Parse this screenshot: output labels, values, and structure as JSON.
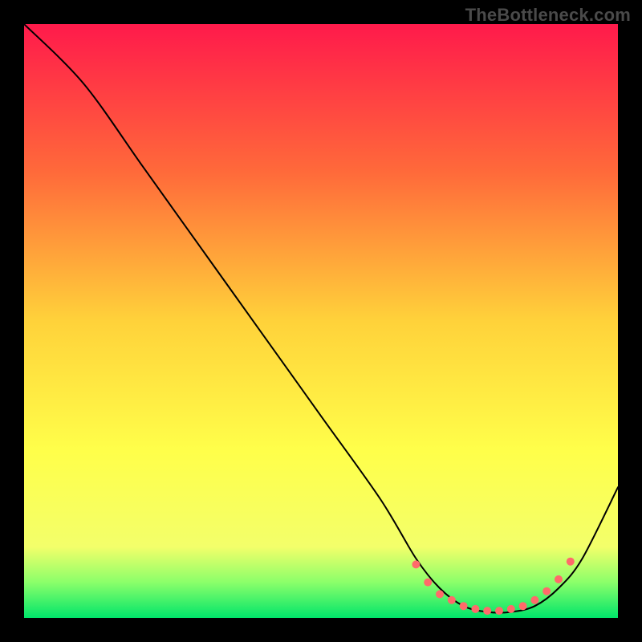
{
  "watermark": "TheBottleneck.com",
  "chart_data": {
    "type": "line",
    "title": "",
    "xlabel": "",
    "ylabel": "",
    "xlim": [
      0,
      100
    ],
    "ylim": [
      0,
      100
    ],
    "grid": false,
    "legend": false,
    "background_gradient": {
      "stops": [
        {
          "offset": 0.0,
          "color": "#ff1a4b"
        },
        {
          "offset": 0.25,
          "color": "#ff6a3a"
        },
        {
          "offset": 0.5,
          "color": "#ffd23a"
        },
        {
          "offset": 0.72,
          "color": "#ffff4a"
        },
        {
          "offset": 0.88,
          "color": "#f3ff6a"
        },
        {
          "offset": 0.94,
          "color": "#8bff6a"
        },
        {
          "offset": 1.0,
          "color": "#00e56a"
        }
      ]
    },
    "series": [
      {
        "name": "curve",
        "x": [
          0,
          10,
          20,
          30,
          40,
          50,
          60,
          66,
          70,
          74,
          78,
          82,
          86,
          90,
          94,
          100
        ],
        "y": [
          100,
          90,
          76,
          62,
          48,
          34,
          20,
          10,
          5,
          2,
          1,
          1,
          2,
          5,
          10,
          22
        ],
        "stroke": "#000000",
        "stroke_width": 2
      }
    ],
    "markers": {
      "name": "points",
      "x": [
        66,
        68,
        70,
        72,
        74,
        76,
        78,
        80,
        82,
        84,
        86,
        88,
        90,
        92
      ],
      "y": [
        9,
        6,
        4,
        3,
        2,
        1.5,
        1.2,
        1.2,
        1.5,
        2,
        3,
        4.5,
        6.5,
        9.5
      ],
      "color": "#ff6a6a",
      "radius": 5
    }
  }
}
